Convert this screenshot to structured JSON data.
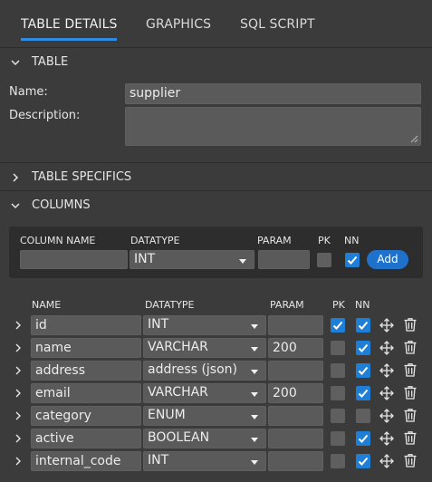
{
  "tabs": [
    {
      "label": "TABLE DETAILS",
      "active": true
    },
    {
      "label": "GRAPHICS",
      "active": false
    },
    {
      "label": "SQL SCRIPT",
      "active": false
    }
  ],
  "sections": {
    "table": "TABLE",
    "table_specifics": "TABLE SPECIFICS",
    "columns": "COLUMNS"
  },
  "table_form": {
    "name_label": "Name:",
    "name_value": "supplier",
    "description_label": "Description:",
    "description_value": ""
  },
  "new_column": {
    "headers": {
      "name": "COLUMN NAME",
      "datatype": "DATATYPE",
      "param": "PARAM",
      "pk": "PK",
      "nn": "NN"
    },
    "name_value": "",
    "datatype_value": "INT",
    "param_value": "",
    "pk_checked": false,
    "nn_checked": true,
    "add_label": "Add"
  },
  "columns_table": {
    "headers": {
      "name": "NAME",
      "datatype": "DATATYPE",
      "param": "PARAM",
      "pk": "PK",
      "nn": "NN"
    },
    "rows": [
      {
        "name": "id",
        "datatype": "INT",
        "param": "",
        "pk": true,
        "nn": true
      },
      {
        "name": "name",
        "datatype": "VARCHAR",
        "param": "200",
        "pk": false,
        "nn": true
      },
      {
        "name": "address",
        "datatype": "address (json)",
        "param": "",
        "pk": false,
        "nn": true
      },
      {
        "name": "email",
        "datatype": "VARCHAR",
        "param": "200",
        "pk": false,
        "nn": true
      },
      {
        "name": "category",
        "datatype": "ENUM",
        "param": "",
        "pk": false,
        "nn": false
      },
      {
        "name": "active",
        "datatype": "BOOLEAN",
        "param": "",
        "pk": false,
        "nn": true
      },
      {
        "name": "internal_code",
        "datatype": "INT",
        "param": "",
        "pk": false,
        "nn": true
      }
    ]
  },
  "icons": {
    "expand": "chevron-down-icon",
    "collapse": "chevron-right-icon",
    "move": "move-arrows-icon",
    "delete": "trash-icon",
    "check": "checkmark-icon"
  },
  "colors": {
    "background": "#3b3b3b",
    "input_bg": "#5a5a5a",
    "accent": "#1f7fd6",
    "tab_underline": "#2e8ce6",
    "panel_dark": "#2d2d2d"
  }
}
